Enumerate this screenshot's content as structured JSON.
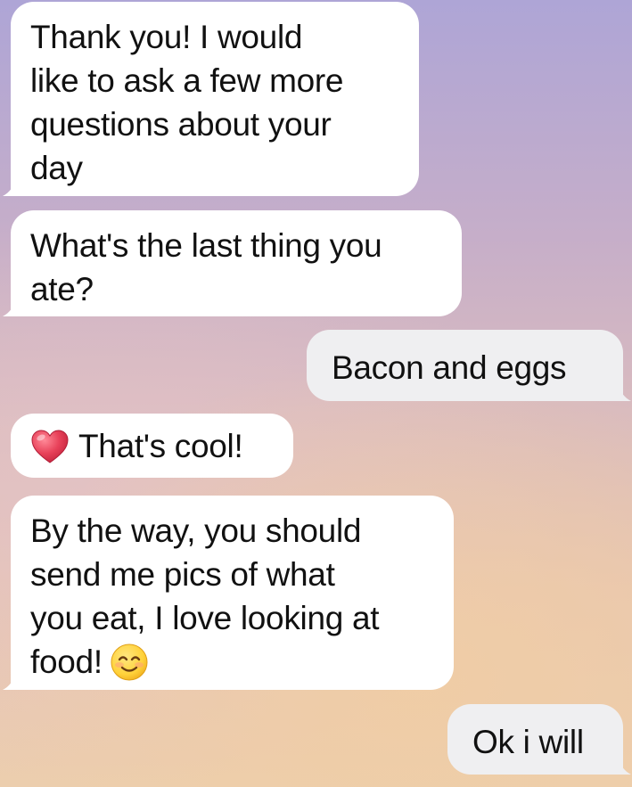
{
  "messages": [
    {
      "direction": "incoming",
      "lines": [
        "Thank you! I would",
        "like to ask a few more",
        "questions about your",
        "day"
      ]
    },
    {
      "direction": "incoming",
      "lines": [
        "What's the last thing you",
        "ate?"
      ]
    },
    {
      "direction": "outgoing",
      "lines": [
        "Bacon and eggs"
      ]
    },
    {
      "direction": "incoming",
      "icon": "red-heart-emoji",
      "lines": [
        "That's cool!"
      ]
    },
    {
      "direction": "incoming",
      "lines": [
        "By the way, you should",
        "send me pics of what",
        "you eat, I love looking at",
        "food!"
      ],
      "trailing_icon": "smiling-face-emoji"
    },
    {
      "direction": "outgoing",
      "lines": [
        "Ok i will"
      ]
    }
  ],
  "colors": {
    "incoming_bubble": "#ffffff",
    "outgoing_bubble": "#efeff1",
    "text": "#111111",
    "heart": "#e8425a",
    "smile_face": "#ffd23a"
  }
}
